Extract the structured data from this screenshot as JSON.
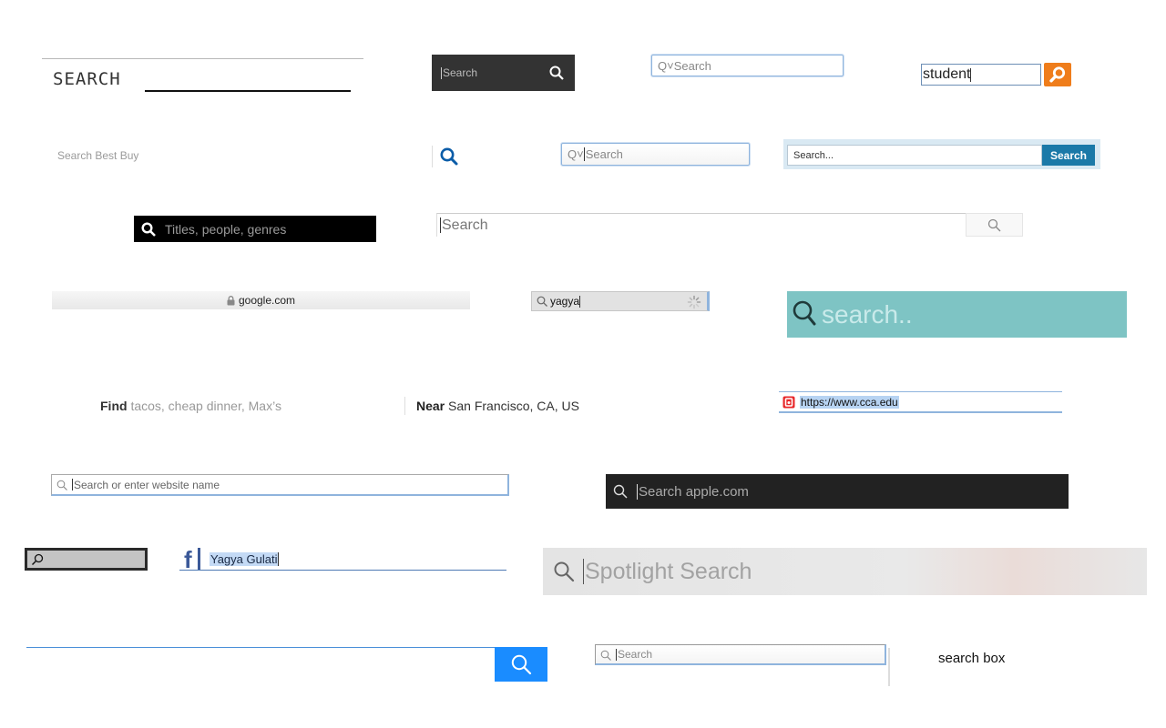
{
  "samples": {
    "s1": {
      "label": "SEARCH"
    },
    "s2": {
      "placeholder": "Search",
      "icon": "search-icon"
    },
    "s3": {
      "placeholder": "Q˅Search"
    },
    "s4": {
      "value": "student",
      "button_icon": "magnifier-icon"
    },
    "s5": {
      "placeholder": "Search Best Buy"
    },
    "s6": {
      "icon": "search-icon"
    },
    "s7": {
      "prefix": "Q˅",
      "placeholder": "Search"
    },
    "s8": {
      "placeholder": "Search...",
      "button": "Search"
    },
    "s9": {
      "placeholder": "Titles, people, genres"
    },
    "s10": {
      "placeholder": "Search"
    },
    "s11": {
      "url": "google.com",
      "icon": "lock-icon"
    },
    "s12": {
      "value": "yagya",
      "status": "loading"
    },
    "s13": {
      "placeholder": "search.."
    },
    "s14": {
      "find_label": "Find",
      "find_placeholder": "tacos, cheap dinner, Max’s",
      "near_label": "Near",
      "near_value": "San Francisco, CA, US"
    },
    "s15": {
      "url": "https://www.cca.edu",
      "icon": "site-icon"
    },
    "s16": {
      "placeholder": "Search or enter website name"
    },
    "s17": {
      "placeholder": "Search apple.com"
    },
    "s18": {
      "icon": "search-icon"
    },
    "s19": {
      "logo": "f",
      "value": "Yagya Gulati"
    },
    "s20": {
      "placeholder": "Spotlight Search"
    },
    "s21": {
      "icon": "search-icon"
    },
    "s22": {
      "placeholder": "Search"
    },
    "s23": {
      "label": "search box"
    }
  },
  "colors": {
    "bestbuy_blue": "#0a5ca8",
    "orange": "#ef7d1b",
    "teal": "#7ec4c4",
    "button_blue": "#1a8cff",
    "facebook_blue": "#3b5998"
  }
}
